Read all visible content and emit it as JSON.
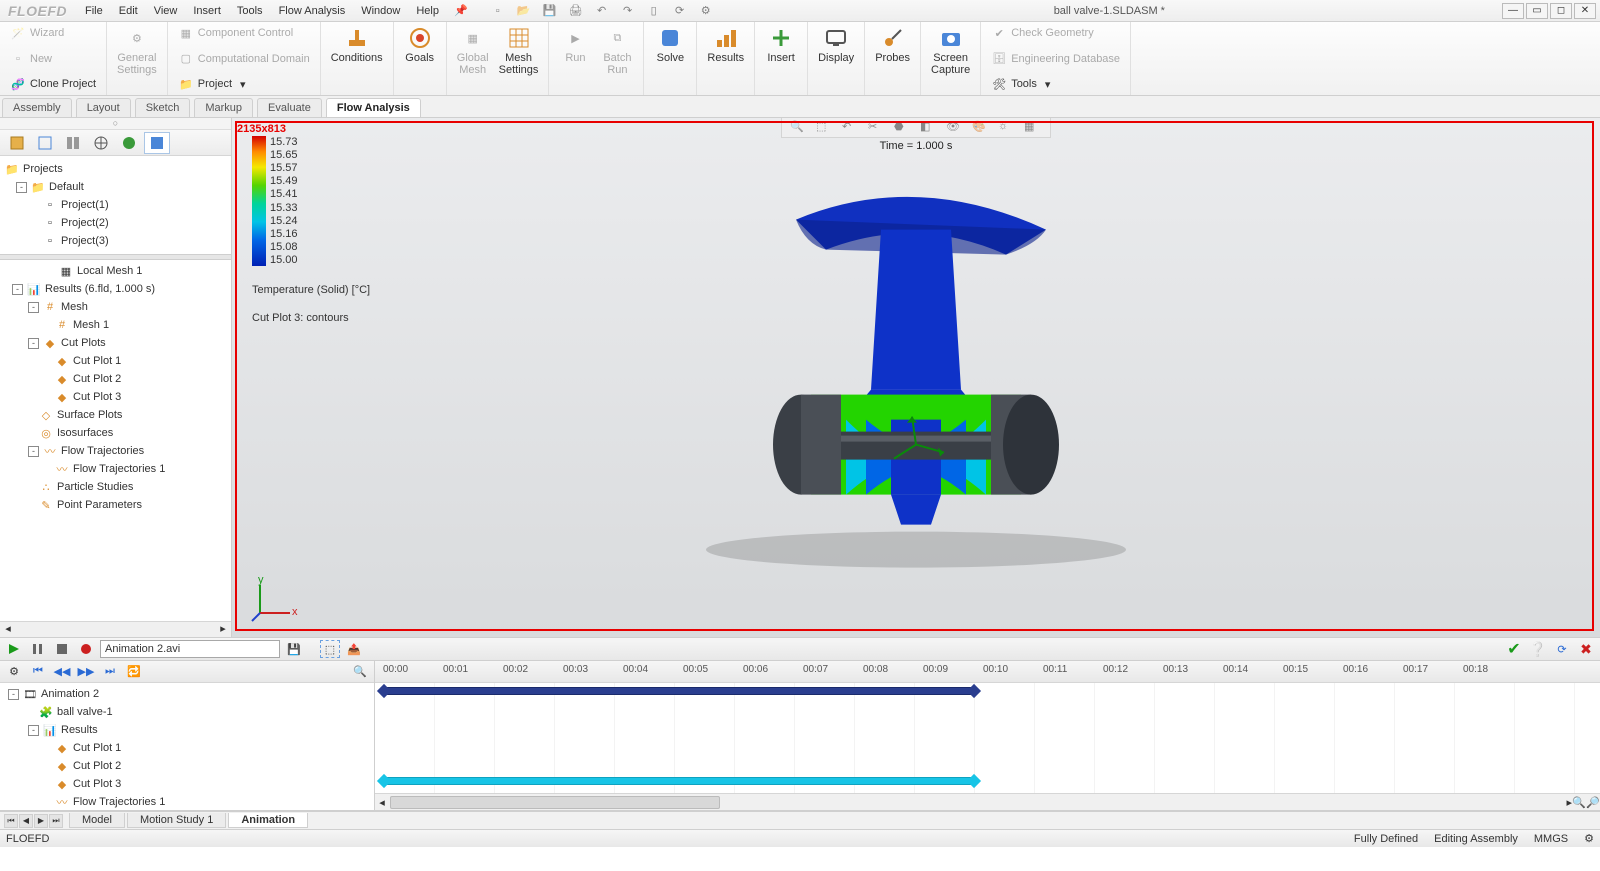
{
  "app": {
    "logo": "FLOEFD",
    "title": "ball valve-1.SLDASM *"
  },
  "menu": [
    "File",
    "Edit",
    "View",
    "Insert",
    "Tools",
    "Flow Analysis",
    "Window",
    "Help"
  ],
  "ribbon": {
    "left_small": [
      {
        "label": "Wizard",
        "disabled": true
      },
      {
        "label": "New",
        "disabled": true
      },
      {
        "label": "Clone Project",
        "disabled": false
      }
    ],
    "general_settings": "General\nSettings",
    "component_control": "Component Control",
    "computational_domain": "Computational Domain",
    "project": "Project",
    "conditions": "Conditions",
    "goals": "Goals",
    "global_mesh": "Global\nMesh",
    "mesh_settings": "Mesh\nSettings",
    "run": "Run",
    "batch_run": "Batch\nRun",
    "solve": "Solve",
    "results": "Results",
    "insert": "Insert",
    "display": "Display",
    "probes": "Probes",
    "screen_capture": "Screen\nCapture",
    "check_geometry": "Check Geometry",
    "engineering_db": "Engineering Database",
    "tools": "Tools"
  },
  "cmd_tabs": [
    "Assembly",
    "Layout",
    "Sketch",
    "Markup",
    "Evaluate",
    "Flow Analysis"
  ],
  "cmd_tab_active": 5,
  "projects": {
    "root": "Projects",
    "default": "Default",
    "items": [
      "Project(1)",
      "Project(2)",
      "Project(3)"
    ]
  },
  "results_tree": {
    "local_mesh": "Local Mesh 1",
    "results": "Results (6.fld, 1.000 s)",
    "mesh": "Mesh",
    "mesh1": "Mesh 1",
    "cutplots": "Cut Plots",
    "cutplot_items": [
      "Cut Plot 1",
      "Cut Plot 2",
      "Cut Plot 3"
    ],
    "surface_plots": "Surface Plots",
    "isosurfaces": "Isosurfaces",
    "flow_traj": "Flow Trajectories",
    "flow_traj1": "Flow Trajectories 1",
    "particle": "Particle Studies",
    "point_params": "Point Parameters"
  },
  "viewport": {
    "dim": "2135x813",
    "time": "Time = 1.000 s",
    "legend_values": [
      "15.73",
      "15.65",
      "15.57",
      "15.49",
      "15.41",
      "15.33",
      "15.24",
      "15.16",
      "15.08",
      "15.00"
    ],
    "legend_title": "Temperature (Solid) [°C]",
    "legend_sub": "Cut Plot 3: contours"
  },
  "animation": {
    "file": "Animation 2.avi",
    "root": "Animation 2",
    "asm": "ball valve-1",
    "results": "Results",
    "items": [
      "Cut Plot 1",
      "Cut Plot 2",
      "Cut Plot 3",
      "Flow Trajectories 1"
    ],
    "time_ticks": [
      "00:00",
      "00:01",
      "00:02",
      "00:03",
      "00:04",
      "00:05",
      "00:06",
      "00:07",
      "00:08",
      "00:09",
      "00:10",
      "00:11",
      "00:12",
      "00:13",
      "00:14",
      "00:15",
      "00:16",
      "00:17",
      "00:18"
    ]
  },
  "bottom_tabs": [
    "Model",
    "Motion Study 1",
    "Animation"
  ],
  "bottom_tab_active": 2,
  "status": {
    "left": "FLOEFD",
    "defined": "Fully Defined",
    "mode": "Editing Assembly",
    "units": "MMGS"
  }
}
